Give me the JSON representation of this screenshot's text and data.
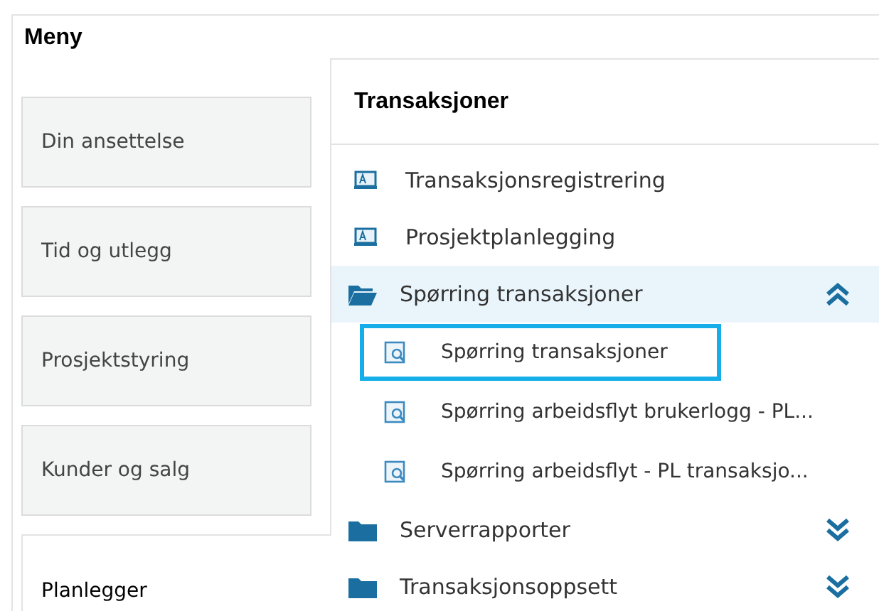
{
  "title": "Meny",
  "categories": [
    {
      "label": "Din ansettelse",
      "selected": false
    },
    {
      "label": "Tid og utlegg",
      "selected": false
    },
    {
      "label": "Prosjektstyring",
      "selected": false
    },
    {
      "label": "Kunder og salg",
      "selected": false
    },
    {
      "label": "Planlegger",
      "selected": true
    }
  ],
  "panel": {
    "title": "Transaksjoner",
    "items": [
      {
        "kind": "form",
        "label": "Transaksjonsregistrering"
      },
      {
        "kind": "form",
        "label": "Prosjektplanlegging"
      },
      {
        "kind": "folder",
        "label": "Spørring transaksjoner",
        "expanded": true,
        "children": [
          {
            "kind": "query",
            "label": "Spørring transaksjoner",
            "selected": true
          },
          {
            "kind": "query",
            "label": "Spørring arbeidsflyt brukerlogg - PL...",
            "selected": false
          },
          {
            "kind": "query",
            "label": "Spørring arbeidsflyt - PL transaksjo...",
            "selected": false
          }
        ]
      },
      {
        "kind": "folder",
        "label": "Serverrapporter",
        "expanded": false
      },
      {
        "kind": "folder",
        "label": "Transaksjonsoppsett",
        "expanded": false
      }
    ]
  }
}
